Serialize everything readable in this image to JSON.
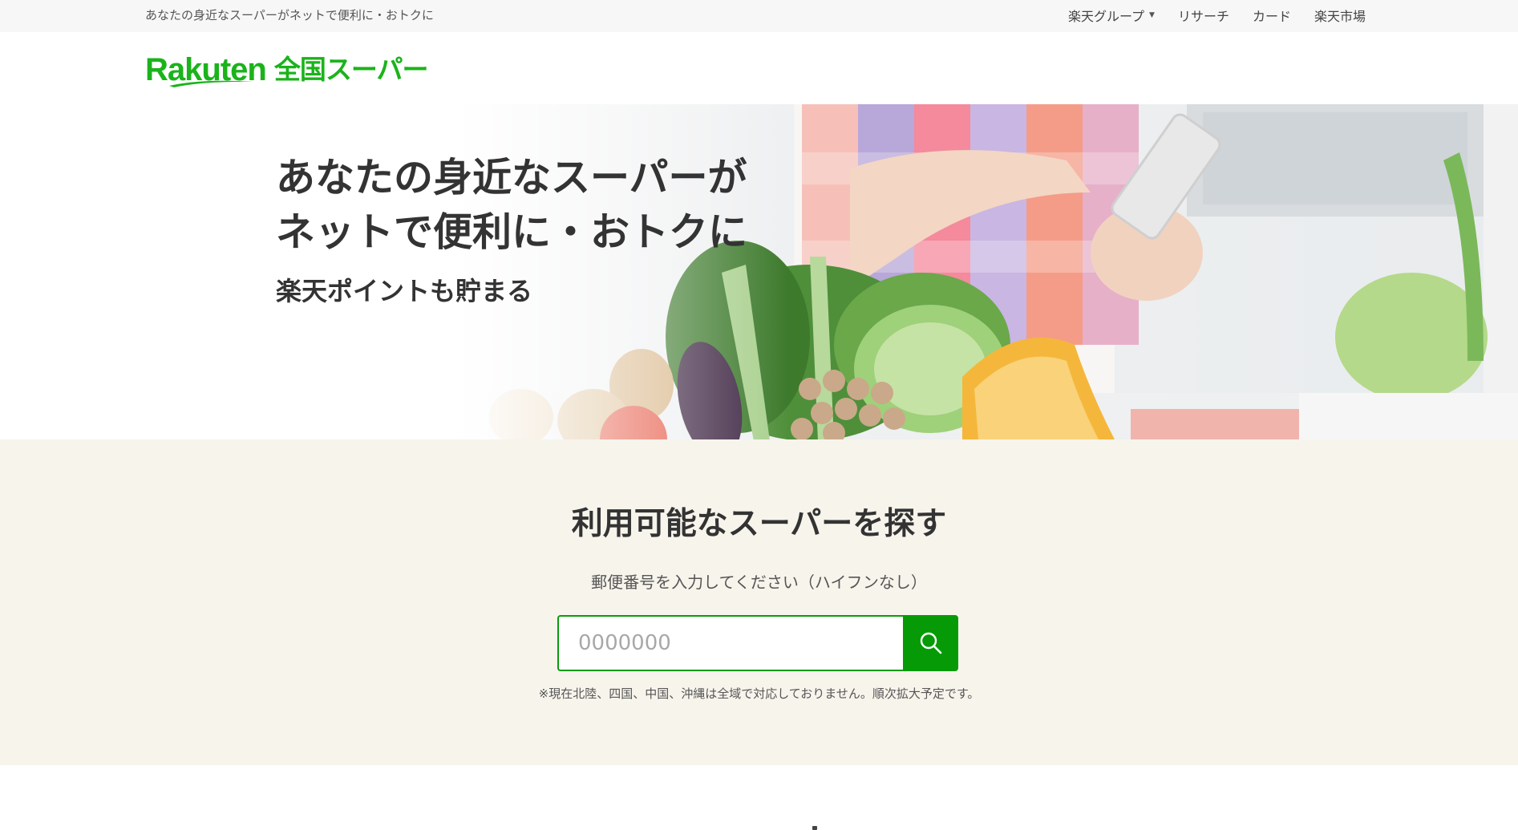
{
  "topbar": {
    "tagline": "あなたの身近なスーパーがネットで便利に・おトクに",
    "nav": [
      {
        "label": "楽天グループ",
        "has_dropdown": true
      },
      {
        "label": "リサーチ"
      },
      {
        "label": "カード"
      },
      {
        "label": "楽天市場"
      }
    ]
  },
  "logo": {
    "brand": "Rakuten",
    "service": "全国スーパー",
    "color": "#1bb31b"
  },
  "hero": {
    "title_line1": "あなたの身近なスーパーが",
    "title_line2": "ネットで便利に・おトクに",
    "subtitle": "楽天ポイントも貯まる"
  },
  "search": {
    "heading": "利用可能なスーパーを探す",
    "instruction": "郵便番号を入力してください（ハイフンなし）",
    "placeholder": "0000000",
    "button_icon": "search-icon",
    "note": "※現在北陸、四国、中国、沖縄は全域で対応しておりません。順次拡大予定です。",
    "accent_color": "#069b06"
  },
  "colors": {
    "topbar_bg": "#f7f7f7",
    "section_bg": "#f7f4ec",
    "text": "#333333"
  }
}
